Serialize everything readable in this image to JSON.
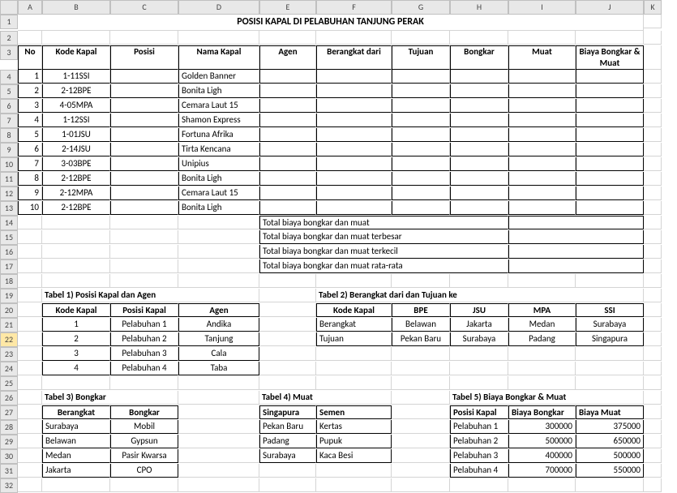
{
  "cols": [
    "A",
    "B",
    "C",
    "D",
    "E",
    "F",
    "G",
    "H",
    "I",
    "J",
    "K"
  ],
  "rows": [
    "1",
    "2",
    "3",
    "4",
    "5",
    "6",
    "7",
    "8",
    "9",
    "10",
    "11",
    "12",
    "13",
    "14",
    "15",
    "16",
    "17",
    "18",
    "19",
    "20",
    "21",
    "22",
    "23",
    "24",
    "25",
    "26",
    "27",
    "28",
    "29",
    "30",
    "31",
    "32"
  ],
  "title": "POSISI KAPAL DI PELABUHAN TANJUNG PERAK",
  "main_headers": [
    "No",
    "Kode Kapal",
    "Posisi",
    "Nama Kapal",
    "Agen",
    "Berangkat dari",
    "Tujuan",
    "Bongkar",
    "Muat",
    "Biaya Bongkar & Muat"
  ],
  "main_rows": [
    {
      "no": "1",
      "kode": "1-11SSI",
      "nama": "Golden Banner"
    },
    {
      "no": "2",
      "kode": "2-12BPE",
      "nama": "Bonita Ligh"
    },
    {
      "no": "3",
      "kode": "4-05MPA",
      "nama": "Cemara Laut 15"
    },
    {
      "no": "4",
      "kode": "1-12SSI",
      "nama": "Shamon Express"
    },
    {
      "no": "5",
      "kode": "1-01JSU",
      "nama": "Fortuna Afrika"
    },
    {
      "no": "6",
      "kode": "2-14JSU",
      "nama": "Tirta Kencana"
    },
    {
      "no": "7",
      "kode": "3-03BPE",
      "nama": "Unipius"
    },
    {
      "no": "8",
      "kode": "2-12BPE",
      "nama": "Bonita Ligh"
    },
    {
      "no": "9",
      "kode": "2-12MPA",
      "nama": "Cemara Laut 15"
    },
    {
      "no": "10",
      "kode": "2-12BPE",
      "nama": "Bonita Ligh"
    }
  ],
  "totals": [
    "Total biaya bongkar dan muat",
    "Total biaya bongkar dan muat terbesar",
    "Total biaya bongkar dan muat terkecil",
    "Total biaya bongkar dan muat rata-rata"
  ],
  "t1": {
    "title": "Tabel 1) Posisi Kapal dan Agen",
    "headers": [
      "Kode Kapal",
      "Posisi Kapal",
      "Agen"
    ],
    "rows": [
      [
        "1",
        "Pelabuhan 1",
        "Andika"
      ],
      [
        "2",
        "Pelabuhan 2",
        "Tanjung"
      ],
      [
        "3",
        "Pelabuhan 3",
        "Cala"
      ],
      [
        "4",
        "Pelabuhan 4",
        "Taba"
      ]
    ]
  },
  "t2": {
    "title": "Tabel 2) Berangkat dari dan Tujuan ke",
    "headers": [
      "Kode Kapal",
      "BPE",
      "JSU",
      "MPA",
      "SSI"
    ],
    "rows": [
      [
        "Berangkat",
        "Belawan",
        "Jakarta",
        "Medan",
        "Surabaya"
      ],
      [
        "Tujuan",
        "Pekan Baru",
        "Surabaya",
        "Padang",
        "Singapura"
      ]
    ]
  },
  "t3": {
    "title": "Tabel 3) Bongkar",
    "headers": [
      "Berangkat",
      "Bongkar"
    ],
    "rows": [
      [
        "Surabaya",
        "Mobil"
      ],
      [
        "Belawan",
        "Gypsun"
      ],
      [
        "Medan",
        "Pasir Kwarsa"
      ],
      [
        "Jakarta",
        "CPO"
      ]
    ]
  },
  "t4": {
    "title": "Tabel 4) Muat",
    "headers": [
      "Singapura",
      "Semen"
    ],
    "rows": [
      [
        "Pekan Baru",
        "Kertas"
      ],
      [
        "Padang",
        "Pupuk"
      ],
      [
        "Surabaya",
        "Kaca Besi"
      ]
    ]
  },
  "t5": {
    "title": "Tabel 5) Biaya Bongkar & Muat",
    "headers": [
      "Posisi Kapal",
      "Biaya Bongkar",
      "Biaya Muat"
    ],
    "rows": [
      [
        "Pelabuhan 1",
        "300000",
        "375000"
      ],
      [
        "Pelabuhan 2",
        "500000",
        "650000"
      ],
      [
        "Pelabuhan 3",
        "400000",
        "500000"
      ],
      [
        "Pelabuhan 4",
        "700000",
        "550000"
      ]
    ]
  },
  "chart_data": {
    "type": "table",
    "title": "POSISI KAPAL DI PELABUHAN TANJUNG PERAK",
    "main": {
      "columns": [
        "No",
        "Kode Kapal",
        "Posisi",
        "Nama Kapal",
        "Agen",
        "Berangkat dari",
        "Tujuan",
        "Bongkar",
        "Muat",
        "Biaya Bongkar & Muat"
      ],
      "rows": [
        [
          1,
          "1-11SSI",
          "",
          "Golden Banner",
          "",
          "",
          "",
          "",
          "",
          ""
        ],
        [
          2,
          "2-12BPE",
          "",
          "Bonita Ligh",
          "",
          "",
          "",
          "",
          "",
          ""
        ],
        [
          3,
          "4-05MPA",
          "",
          "Cemara Laut 15",
          "",
          "",
          "",
          "",
          "",
          ""
        ],
        [
          4,
          "1-12SSI",
          "",
          "Shamon Express",
          "",
          "",
          "",
          "",
          "",
          ""
        ],
        [
          5,
          "1-01JSU",
          "",
          "Fortuna Afrika",
          "",
          "",
          "",
          "",
          "",
          ""
        ],
        [
          6,
          "2-14JSU",
          "",
          "Tirta Kencana",
          "",
          "",
          "",
          "",
          "",
          ""
        ],
        [
          7,
          "3-03BPE",
          "",
          "Unipius",
          "",
          "",
          "",
          "",
          "",
          ""
        ],
        [
          8,
          "2-12BPE",
          "",
          "Bonita Ligh",
          "",
          "",
          "",
          "",
          "",
          ""
        ],
        [
          9,
          "2-12MPA",
          "",
          "Cemara Laut 15",
          "",
          "",
          "",
          "",
          "",
          ""
        ],
        [
          10,
          "2-12BPE",
          "",
          "Bonita Ligh",
          "",
          "",
          "",
          "",
          "",
          ""
        ]
      ]
    },
    "lookup_tables": {
      "posisi_agen": [
        [
          1,
          "Pelabuhan 1",
          "Andika"
        ],
        [
          2,
          "Pelabuhan 2",
          "Tanjung"
        ],
        [
          3,
          "Pelabuhan 3",
          "Cala"
        ],
        [
          4,
          "Pelabuhan 4",
          "Taba"
        ]
      ],
      "berangkat_tujuan": {
        "BPE": [
          "Belawan",
          "Pekan Baru"
        ],
        "JSU": [
          "Jakarta",
          "Surabaya"
        ],
        "MPA": [
          "Medan",
          "Padang"
        ],
        "SSI": [
          "Surabaya",
          "Singapura"
        ]
      },
      "bongkar": [
        [
          "Surabaya",
          "Mobil"
        ],
        [
          "Belawan",
          "Gypsun"
        ],
        [
          "Medan",
          "Pasir Kwarsa"
        ],
        [
          "Jakarta",
          "CPO"
        ]
      ],
      "muat": [
        [
          "Singapura",
          "Semen"
        ],
        [
          "Pekan Baru",
          "Kertas"
        ],
        [
          "Padang",
          "Pupuk"
        ],
        [
          "Surabaya",
          "Kaca Besi"
        ]
      ],
      "biaya": [
        [
          "Pelabuhan 1",
          300000,
          375000
        ],
        [
          "Pelabuhan 2",
          500000,
          650000
        ],
        [
          "Pelabuhan 3",
          400000,
          500000
        ],
        [
          "Pelabuhan 4",
          700000,
          550000
        ]
      ]
    }
  }
}
